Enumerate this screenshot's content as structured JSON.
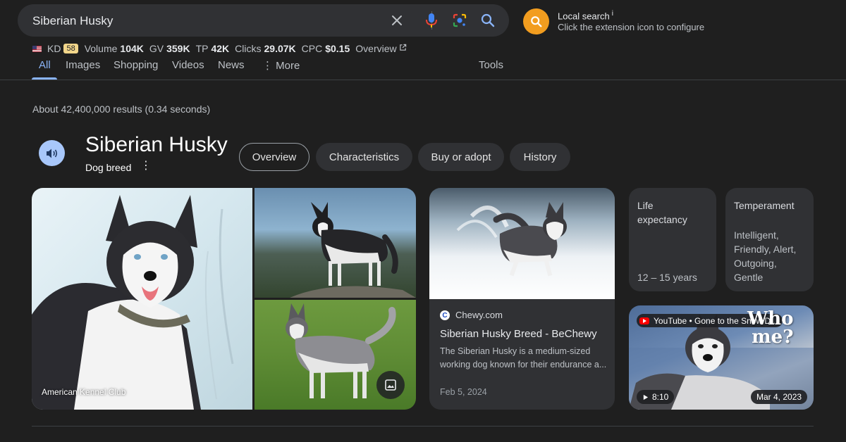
{
  "search": {
    "query": "Siberian Husky"
  },
  "extension": {
    "title": "Local search",
    "info_mark": "i",
    "subtitle": "Click the extension icon to configure"
  },
  "metrics": {
    "kd_label": "KD",
    "kd_value": "58",
    "volume_label": "Volume",
    "volume_value": "104K",
    "gv_label": "GV",
    "gv_value": "359K",
    "tp_label": "TP",
    "tp_value": "42K",
    "clicks_label": "Clicks",
    "clicks_value": "29.07K",
    "cpc_label": "CPC",
    "cpc_value": "$0.15",
    "overview_label": "Overview"
  },
  "tabs": {
    "all": "All",
    "images": "Images",
    "shopping": "Shopping",
    "videos": "Videos",
    "news": "News",
    "more": "More",
    "tools": "Tools"
  },
  "results": {
    "stats": "About 42,400,000 results (0.34 seconds)"
  },
  "knowledge_panel": {
    "title": "Siberian Husky",
    "subtitle": "Dog breed",
    "chips": [
      "Overview",
      "Characteristics",
      "Buy or adopt",
      "History"
    ],
    "selected_chip": "Overview"
  },
  "images": {
    "credit": "American Kennel Club"
  },
  "chewy_card": {
    "source": "Chewy.com",
    "favicon_letter": "C",
    "title": "Siberian Husky Breed - BeChewy",
    "snippet": "The Siberian Husky is a medium-sized working dog known for their endurance a...",
    "date": "Feb 5, 2024"
  },
  "life_card": {
    "label_line1": "Life",
    "label_line2": "expectancy",
    "value": "12 – 15 years"
  },
  "temperament_card": {
    "label": "Temperament",
    "values": [
      "Intelligent,",
      "Friendly, Alert,",
      "Outgoing,",
      "Gentle"
    ]
  },
  "youtube_card": {
    "channel": "YouTube • Gone to the Snow D...",
    "overlay_line1": "Who",
    "overlay_line2": "me?",
    "duration": "8:10",
    "date": "Mar 4, 2023"
  },
  "colors": {
    "background": "#1f1f1f",
    "surface": "#303134",
    "link_blue": "#8ab4f8",
    "mic_blue": "#4285f4",
    "extension_orange": "#f29d1f",
    "kd_badge": "#f2d68a"
  }
}
